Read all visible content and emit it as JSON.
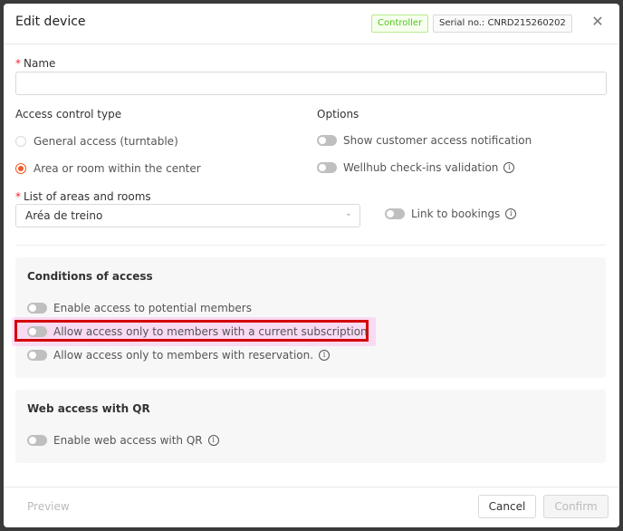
{
  "header": {
    "title": "Edit device",
    "tag_controller": "Controller",
    "tag_serial": "Serial no.: CNRD215260202",
    "close_symbol": "✕"
  },
  "name_field": {
    "label": "Name",
    "required_mark": "*",
    "value": "",
    "placeholder": ""
  },
  "access_control": {
    "title": "Access control type",
    "options": [
      {
        "label": "General access (turntable)",
        "checked": false
      },
      {
        "label": "Area or room within the center",
        "checked": true
      }
    ]
  },
  "options": {
    "title": "Options",
    "items": [
      {
        "label": "Show customer access notification",
        "enabled": false,
        "info": false
      },
      {
        "label": "Wellhub check-ins validation",
        "enabled": false,
        "info": true
      }
    ]
  },
  "areas": {
    "label": "List of areas and rooms",
    "required_mark": "*",
    "selected": "Aréa de treino",
    "link_bookings": "Link to bookings"
  },
  "conditions": {
    "title": "Conditions of access",
    "items": [
      {
        "label": "Enable access to potential members",
        "enabled": false
      },
      {
        "label": "Allow access only to members with a current subscription",
        "enabled": false
      },
      {
        "label": "Allow access only to members with reservation.",
        "enabled": false
      }
    ]
  },
  "web_access": {
    "title": "Web access with QR",
    "toggle_label": "Enable web access with QR"
  },
  "footer": {
    "preview": "Preview",
    "cancel": "Cancel",
    "confirm": "Confirm"
  },
  "icons": {
    "info_glyph": "i",
    "chevron_glyph": "⌄"
  },
  "colors": {
    "accent": "#f05a28",
    "controller_tag": "#52c41a",
    "annotation_red": "#d40000"
  }
}
